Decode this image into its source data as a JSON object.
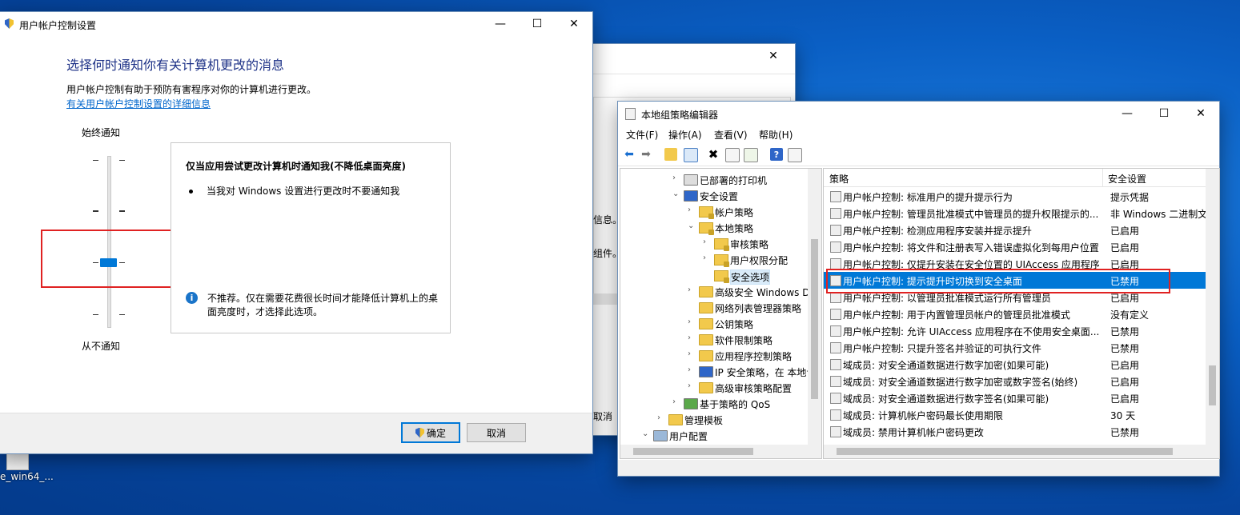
{
  "desktop": {
    "icon_label": "e_win64_..."
  },
  "uac": {
    "title": "用户帐户控制设置",
    "heading": "选择何时通知你有关计算机更改的消息",
    "description": "用户帐户控制有助于预防有害程序对你的计算机进行更改。",
    "link": "有关用户帐户控制设置的详细信息",
    "top_label": "始终通知",
    "bottom_label": "从不通知",
    "slider_level": "3 of 4 (from top)",
    "panel_title": "仅当应用尝试更改计算机时通知我(不降低桌面亮度)",
    "panel_bullet": "当我对 Windows 设置进行更改时不要通知我",
    "panel_note": "不推荐。仅在需要花费很长时间才能降低计算机上的桌面亮度时，才选择此选项。",
    "ok_label": "确定",
    "cancel_label": "取消"
  },
  "bgwin": {
    "text1": "信息。",
    "text2": "组件。",
    "cancel": "取消"
  },
  "gpedit": {
    "title": "本地组策略编辑器",
    "menu": [
      "文件(F)",
      "操作(A)",
      "查看(V)",
      "帮助(H)"
    ],
    "tree": [
      {
        "label": "已部署的打印机",
        "indent": 1,
        "arrow": "›",
        "icon": "printer"
      },
      {
        "label": "安全设置",
        "indent": 1,
        "arrow": "⌄",
        "icon": "shield"
      },
      {
        "label": "帐户策略",
        "indent": 2,
        "arrow": "›",
        "icon": "lockfolder"
      },
      {
        "label": "本地策略",
        "indent": 2,
        "arrow": "⌄",
        "icon": "lockfolder"
      },
      {
        "label": "审核策略",
        "indent": 3,
        "arrow": "›",
        "icon": "lockfolder"
      },
      {
        "label": "用户权限分配",
        "indent": 3,
        "arrow": "›",
        "icon": "lockfolder"
      },
      {
        "label": "安全选项",
        "indent": 3,
        "arrow": "",
        "icon": "lockfolder",
        "selected": true
      },
      {
        "label": "高级安全 Windows Defe",
        "indent": 2,
        "arrow": "›",
        "icon": "folder"
      },
      {
        "label": "网络列表管理器策略",
        "indent": 2,
        "arrow": "",
        "icon": "folder"
      },
      {
        "label": "公钥策略",
        "indent": 2,
        "arrow": "›",
        "icon": "folder"
      },
      {
        "label": "软件限制策略",
        "indent": 2,
        "arrow": "›",
        "icon": "folder"
      },
      {
        "label": "应用程序控制策略",
        "indent": 2,
        "arrow": "›",
        "icon": "folder"
      },
      {
        "label": "IP 安全策略，在 本地计",
        "indent": 2,
        "arrow": "›",
        "icon": "shield"
      },
      {
        "label": "高级审核策略配置",
        "indent": 2,
        "arrow": "›",
        "icon": "folder"
      },
      {
        "label": "基于策略的 QoS",
        "indent": 1,
        "arrow": "›",
        "icon": "chart"
      },
      {
        "label": "管理模板",
        "indent": 0,
        "arrow": "›",
        "icon": "folder"
      },
      {
        "label": "用户配置",
        "indent": -1,
        "arrow": "⌄",
        "icon": "user"
      }
    ],
    "col_policy": "策略",
    "col_setting": "安全设置",
    "rows": [
      {
        "name": "用户帐户控制: 标准用户的提升提示行为",
        "value": "提示凭据"
      },
      {
        "name": "用户帐户控制: 管理员批准模式中管理员的提升权限提示的...",
        "value": "非 Windows 二进制文"
      },
      {
        "name": "用户帐户控制: 检测应用程序安装并提示提升",
        "value": "已启用"
      },
      {
        "name": "用户帐户控制: 将文件和注册表写入错误虚拟化到每用户位置",
        "value": "已启用"
      },
      {
        "name": "用户帐户控制: 仅提升安装在安全位置的 UIAccess 应用程序",
        "value": "已启用"
      },
      {
        "name": "用户帐户控制: 提示提升时切换到安全桌面",
        "value": "已禁用",
        "selected": true
      },
      {
        "name": "用户帐户控制: 以管理员批准模式运行所有管理员",
        "value": "已启用"
      },
      {
        "name": "用户帐户控制: 用于内置管理员帐户的管理员批准模式",
        "value": "没有定义"
      },
      {
        "name": "用户帐户控制: 允许 UIAccess 应用程序在不使用安全桌面...",
        "value": "已禁用"
      },
      {
        "name": "用户帐户控制: 只提升签名并验证的可执行文件",
        "value": "已禁用"
      },
      {
        "name": "域成员: 对安全通道数据进行数字加密(如果可能)",
        "value": "已启用"
      },
      {
        "name": "域成员: 对安全通道数据进行数字加密或数字签名(始终)",
        "value": "已启用"
      },
      {
        "name": "域成员: 对安全通道数据进行数字签名(如果可能)",
        "value": "已启用"
      },
      {
        "name": "域成员: 计算机帐户密码最长使用期限",
        "value": "30 天"
      },
      {
        "name": "域成员: 禁用计算机帐户密码更改",
        "value": "已禁用"
      }
    ]
  }
}
